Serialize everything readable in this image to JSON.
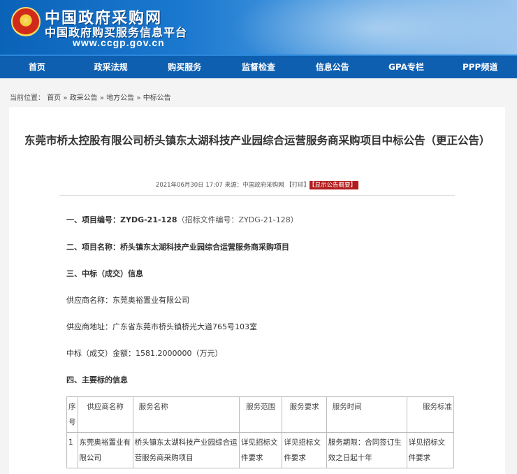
{
  "header": {
    "emblem_glyph": "★",
    "site_title": "中国政府采购网",
    "site_subtitle": "中国政府购买服务信息平台",
    "site_url": "www.ccgp.gov.cn"
  },
  "nav": {
    "items": [
      {
        "label": "首页"
      },
      {
        "label": "政采法规"
      },
      {
        "label": "购买服务"
      },
      {
        "label": "监督检查"
      },
      {
        "label": "信息公告"
      },
      {
        "label": "GPA专栏"
      },
      {
        "label": "PPP频道"
      }
    ]
  },
  "breadcrumb": {
    "prefix": "当前位置：",
    "items": [
      "首页",
      "政采公告",
      "地方公告",
      "中标公告"
    ],
    "separator": "»"
  },
  "article": {
    "title": "东莞市桥太控股有限公司桥头镇东太湖科技产业园综合运营服务商采购项目中标公告（更正公告）",
    "meta_text": "2021年06月30日 17:07 来源：中国政府采购网 【打印】",
    "meta_badge": "【显示公告概要】",
    "sections": {
      "s1_label": "一、项目编号：",
      "s1_value": "ZYDG-21-128",
      "s1_extra": "（招标文件编号：ZYDG-21-128）",
      "s2_label": "二、项目名称：",
      "s2_value": "桥头镇东太湖科技产业园综合运营服务商采购项目",
      "s3_label": "三、中标（成交）信息",
      "supplier_name": "供应商名称：东莞奥裕置业有限公司",
      "supplier_address": "供应商地址：广东省东莞市桥头镇桥光大道765号103室",
      "amount": "中标（成交）金额：1581.2000000（万元）",
      "s4_label": "四、主要标的信息"
    },
    "table": {
      "headers": [
        "序号",
        "供应商名称",
        "服务名称",
        "服务范围",
        "服务要求",
        "服务时间",
        "服务标准"
      ],
      "rows": [
        [
          "1",
          "东莞奥裕置业有限公司",
          "桥头镇东太湖科技产业园综合运营服务商采购项目",
          "详见招标文件要求",
          "详见招标文件要求",
          "服务期限：合同签订生效之日起十年",
          "详见招标文件要求"
        ]
      ]
    }
  }
}
